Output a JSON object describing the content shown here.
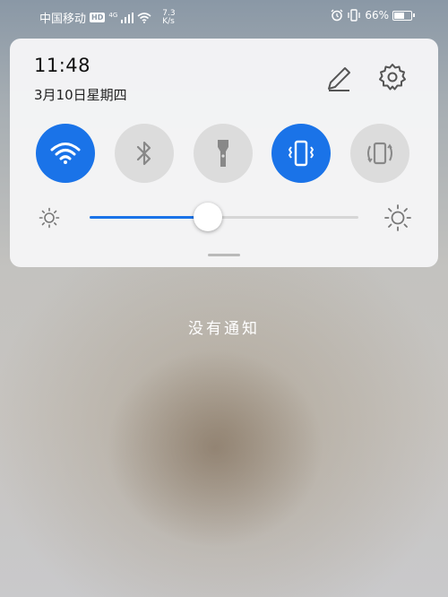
{
  "status_bar": {
    "carrier": "中国移动",
    "hd_badge": "HD",
    "network_type": "4G",
    "speed_value": "7.3",
    "speed_unit": "K/s",
    "battery_percent": "66%",
    "battery_level": 0.66
  },
  "panel": {
    "time": "11:48",
    "date": "3月10日星期四"
  },
  "quick_toggles": [
    {
      "name": "wifi",
      "icon": "wifi-icon",
      "active": true
    },
    {
      "name": "bluetooth",
      "icon": "bluetooth-icon",
      "active": false
    },
    {
      "name": "flashlight",
      "icon": "flashlight-icon",
      "active": false
    },
    {
      "name": "vibrate",
      "icon": "vibrate-icon",
      "active": true
    },
    {
      "name": "auto-rotate",
      "icon": "rotate-icon",
      "active": false
    }
  ],
  "brightness": {
    "level": 0.44
  },
  "notifications": {
    "empty_text": "没有通知"
  },
  "colors": {
    "accent": "#1a73e8",
    "toggle_off": "#dcdcdc",
    "panel_bg": "#f5f5f6"
  }
}
